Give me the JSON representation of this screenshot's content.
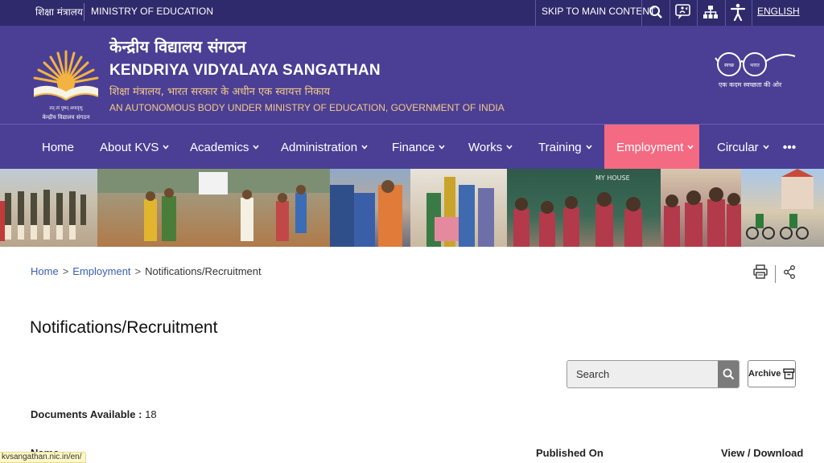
{
  "topbar": {
    "ministry_hi": "शिक्षा मंत्रालय",
    "ministry_en": "MINISTRY OF EDUCATION",
    "skip_label": "SKIP TO MAIN CONTENT",
    "language": "ENGLISH"
  },
  "header": {
    "title_hi": "केन्द्रीय विद्यालय संगठन",
    "title_en": "KENDRIYA VIDYALAYA SANGATHAN",
    "subtitle_hi": "शिक्षा मंत्रालय, भारत सरकार के अधीन एक स्वायत्त निकाय",
    "subtitle_en": "AN AUTONOMOUS BODY UNDER MINISTRY OF EDUCATION, GOVERNMENT OF INDIA",
    "logo_caption": "केन्द्रीय विद्यालय संगठन",
    "logo_motto": "तत् त्वं पूषन् अपावृणु",
    "swachh_left": "स्वच्छ",
    "swachh_right": "भारत",
    "swachh_tagline": "एक कदम स्वच्छता की ओर"
  },
  "nav": {
    "items": [
      {
        "label": "Home",
        "dropdown": false
      },
      {
        "label": "About KVS",
        "dropdown": true
      },
      {
        "label": "Academics",
        "dropdown": true
      },
      {
        "label": "Administration",
        "dropdown": true
      },
      {
        "label": "Finance",
        "dropdown": true
      },
      {
        "label": "Works",
        "dropdown": true
      },
      {
        "label": "Training",
        "dropdown": true
      },
      {
        "label": "Employment",
        "dropdown": true,
        "active": true
      },
      {
        "label": "Circular",
        "dropdown": true
      }
    ],
    "active_color": "#f46a83"
  },
  "breadcrumb": {
    "home": "Home",
    "section": "Employment",
    "current": "Notifications/Recruitment"
  },
  "page": {
    "title": "Notifications/Recruitment",
    "search_placeholder": "Search",
    "archive_label": "Archive",
    "docs_label": "Documents Available :",
    "docs_count": "18"
  },
  "table": {
    "col_name": "Name",
    "col_published": "Published On",
    "col_view": "View / Download"
  },
  "statusbar": {
    "url": "kvsangathan.nic.in/en/"
  },
  "colors": {
    "topbar": "#2f2a6b",
    "header": "#4a3f94",
    "accent": "#f46a83",
    "subtitle": "#f5c98a"
  }
}
